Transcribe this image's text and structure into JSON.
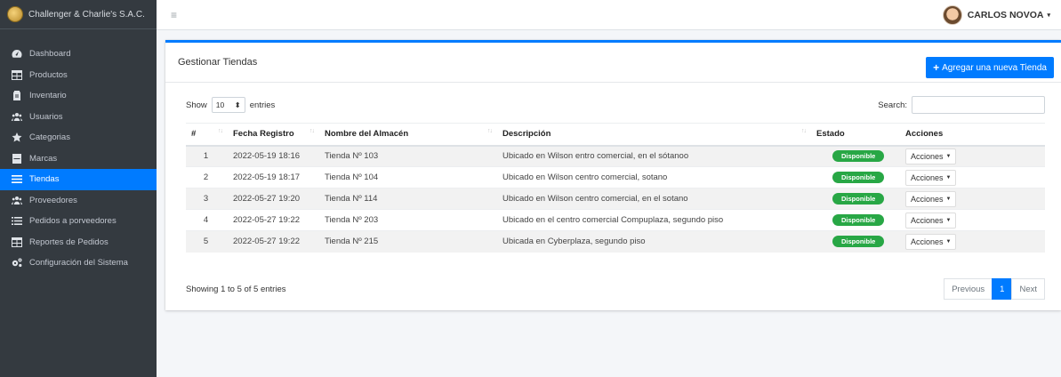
{
  "brand": {
    "name": "Challenger & Charlie's S.A.C."
  },
  "topbar": {
    "menu_icon": "hamburger-icon",
    "user_name": "CARLOS NOVOA",
    "caret": "▾"
  },
  "sidebar": {
    "items": [
      {
        "label": "Dashboard",
        "icon": "tachometer-icon",
        "active": false
      },
      {
        "label": "Productos",
        "icon": "table-icon",
        "active": false
      },
      {
        "label": "Inventario",
        "icon": "clipboard-icon",
        "active": false
      },
      {
        "label": "Usuarios",
        "icon": "users-icon",
        "active": false
      },
      {
        "label": "Categorias",
        "icon": "star-icon",
        "active": false
      },
      {
        "label": "Marcas",
        "icon": "tag-box-icon",
        "active": false
      },
      {
        "label": "Tiendas",
        "icon": "bars-icon",
        "active": true
      },
      {
        "label": "Proveedores",
        "icon": "users-icon",
        "active": false
      },
      {
        "label": "Pedidos a porveedores",
        "icon": "list-icon",
        "active": false
      },
      {
        "label": "Reportes de Pedidos",
        "icon": "table-icon",
        "active": false
      },
      {
        "label": "Configuración del Sistema",
        "icon": "cogs-icon",
        "active": false
      }
    ]
  },
  "card": {
    "title": "Gestionar Tiendas",
    "add_button": "Agregar una nueva Tienda",
    "show_label": "Show",
    "entries_value": "10",
    "entries_label": "entries",
    "search_label": "Search:",
    "search_value": ""
  },
  "table": {
    "headers": [
      "#",
      "Fecha Registro",
      "Nombre del Almacén",
      "Descripción",
      "Estado",
      "Acciones"
    ],
    "rows": [
      {
        "num": "1",
        "fecha": "2022-05-19 18:16",
        "nombre": "Tienda Nº 103",
        "desc": "Ubicado en Wilson entro comercial, en el sótanoo",
        "estado": "Disponible",
        "accion": "Acciones"
      },
      {
        "num": "2",
        "fecha": "2022-05-19 18:17",
        "nombre": "Tienda Nº 104",
        "desc": "Ubicado en Wilson centro comercial, sotano",
        "estado": "Disponible",
        "accion": "Acciones"
      },
      {
        "num": "3",
        "fecha": "2022-05-27 19:20",
        "nombre": "Tienda Nº 114",
        "desc": "Ubicado en Wilson centro comercial, en el sotano",
        "estado": "Disponible",
        "accion": "Acciones"
      },
      {
        "num": "4",
        "fecha": "2022-05-27 19:22",
        "nombre": "Tienda Nº 203",
        "desc": "Ubicado en el centro comercial Compuplaza, segundo piso",
        "estado": "Disponible",
        "accion": "Acciones"
      },
      {
        "num": "5",
        "fecha": "2022-05-27 19:22",
        "nombre": "Tienda Nº 215",
        "desc": "Ubicada en Cyberplaza, segundo piso",
        "estado": "Disponible",
        "accion": "Acciones"
      }
    ]
  },
  "footer": {
    "info": "Showing 1 to 5 of 5 entries",
    "previous": "Previous",
    "page": "1",
    "next": "Next"
  },
  "colors": {
    "primary": "#007bff",
    "sidebar": "#343a40",
    "success": "#28a745"
  }
}
